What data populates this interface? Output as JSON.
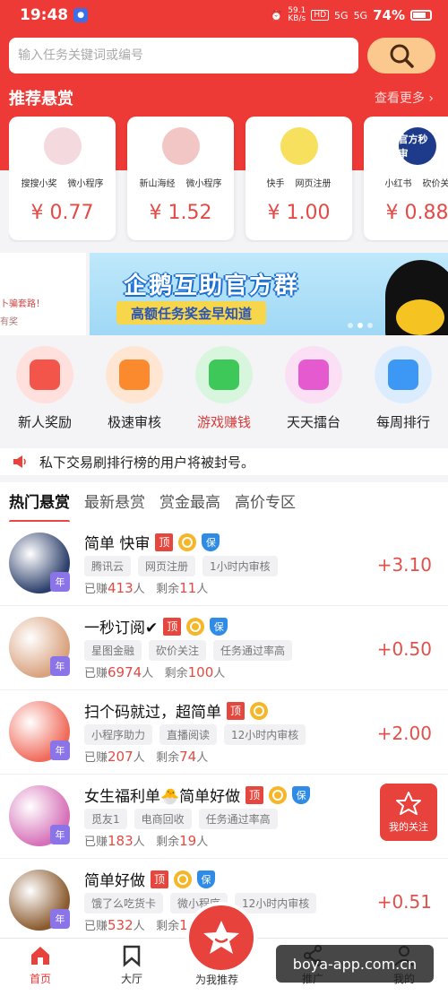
{
  "status_bar": {
    "time": "19:48",
    "speed_top": "59.1",
    "speed_unit": "KB/s",
    "hd": "HD",
    "net1": "5G",
    "net2": "5G",
    "battery": "74%"
  },
  "search": {
    "placeholder": "输入任务关键词或编号"
  },
  "recommend": {
    "title": "推荐悬赏",
    "more": "查看更多 ›",
    "cards": [
      {
        "tag1": "搜搜小奖",
        "tag2": "微小程序",
        "price": "¥ 0.77",
        "color": "#f4d9df"
      },
      {
        "tag1": "新山海经",
        "tag2": "微小程序",
        "price": "¥ 1.52",
        "color": "#f2c6c4"
      },
      {
        "tag1": "快手",
        "tag2": "网页注册",
        "price": "¥ 1.00",
        "color": "#f6e05e"
      },
      {
        "tag1": "小红书",
        "tag2": "砍价关",
        "price": "¥ 0.88",
        "color": "#1d3b8a",
        "avatar_text": "官方秒审"
      }
    ]
  },
  "banner": {
    "left_line1": "卜骗套路！",
    "left_line2": "有奖",
    "title": "企鹅互助官方群",
    "subtitle": "高额任务奖金早知道"
  },
  "grid": [
    {
      "label": "新人奖励",
      "color": "#ffe0dd",
      "inner": "#f4554a"
    },
    {
      "label": "极速审核",
      "color": "#ffe6d2",
      "inner": "#fb8a2f"
    },
    {
      "label": "游戏赚钱",
      "color": "#d8f6de",
      "inner": "#3fc85a",
      "highlight": true
    },
    {
      "label": "天天擂台",
      "color": "#fbdff5",
      "inner": "#e65ad0"
    },
    {
      "label": "每周排行",
      "color": "#dcecff",
      "inner": "#3d97f5"
    }
  ],
  "notice": "私下交易刷排行榜的用户将被封号。",
  "tabs": [
    "热门悬赏",
    "最新悬赏",
    "赏金最高",
    "高价专区"
  ],
  "list": [
    {
      "title": "简单 快审",
      "chips": [
        "腾讯云",
        "网页注册",
        "1小时内审核"
      ],
      "earned_label": "已赚",
      "earned": "413",
      "earned_unit": "人",
      "left_label": "剩余",
      "left": "11",
      "left_unit": "人",
      "price": "+3.10",
      "bao": true,
      "av": "#2c3f6b",
      "year": "年"
    },
    {
      "title": "一秒订阅✔",
      "chips": [
        "星图金融",
        "砍价关注",
        "任务通过率高"
      ],
      "earned_label": "已赚",
      "earned": "6974",
      "earned_unit": "人",
      "left_label": "剩余",
      "left": "100",
      "left_unit": "人",
      "price": "+0.50",
      "bao": true,
      "av": "#d9a27e",
      "year": "年"
    },
    {
      "title": "扫个码就过，超简单",
      "chips": [
        "小程序助力",
        "直播阅读",
        "12小时内审核"
      ],
      "earned_label": "已赚",
      "earned": "207",
      "earned_unit": "人",
      "left_label": "剩余",
      "left": "74",
      "left_unit": "人",
      "price": "+2.00",
      "bao": false,
      "av": "#f06a5a",
      "year": "年"
    },
    {
      "title": "女生福利单🐣简单好做",
      "chips": [
        "觅友1",
        "电商回收",
        "任务通过率高"
      ],
      "earned_label": "已赚",
      "earned": "183",
      "earned_unit": "人",
      "left_label": "剩余",
      "left": "19",
      "left_unit": "人",
      "price": "",
      "bao": true,
      "av": "#d66fb8",
      "year": "年"
    },
    {
      "title": "简单好做",
      "chips": [
        "饿了么吃货卡",
        "微小程序",
        "12小时内审核"
      ],
      "earned_label": "已赚",
      "earned": "532",
      "earned_unit": "人",
      "left_label": "剩余",
      "left": "16",
      "left_unit": "",
      "price": "+0.51",
      "bao": true,
      "av": "#8a5a2e",
      "year": "年"
    }
  ],
  "tag_top": "顶",
  "tag_bao": "保",
  "follow": {
    "label": "我的关注"
  },
  "nav": {
    "home": "首页",
    "hall": "大厅",
    "center": "为我推荐",
    "promote": "推广",
    "mine": "我的"
  },
  "watermark": "boya-app.com.cn"
}
